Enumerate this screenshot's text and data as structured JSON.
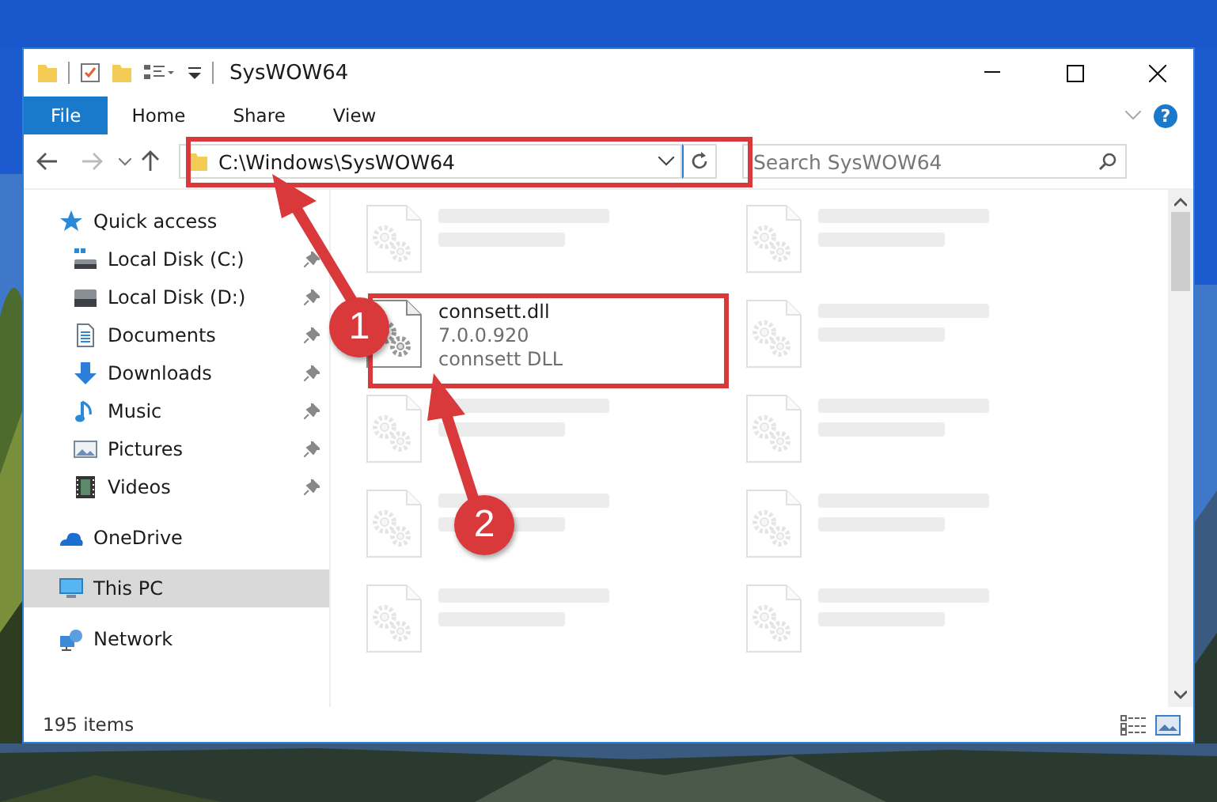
{
  "window": {
    "title": "SysWOW64"
  },
  "ribbon": {
    "tabs": [
      {
        "label": "File",
        "selected": true
      },
      {
        "label": "Home",
        "selected": false
      },
      {
        "label": "Share",
        "selected": false
      },
      {
        "label": "View",
        "selected": false
      }
    ],
    "help": "?"
  },
  "address": {
    "path": "C:\\Windows\\SysWOW64"
  },
  "search": {
    "placeholder": "Search SysWOW64"
  },
  "sidebar": {
    "items": [
      {
        "label": "Quick access",
        "kind": "star",
        "selected": false,
        "children": [
          {
            "label": "Local Disk (C:)",
            "kind": "system-drive",
            "pinned": true,
            "selected": false
          },
          {
            "label": "Local Disk (D:)",
            "kind": "drive",
            "pinned": true,
            "selected": false
          },
          {
            "label": "Documents",
            "kind": "document",
            "pinned": true,
            "selected": false
          },
          {
            "label": "Downloads",
            "kind": "download",
            "pinned": true,
            "selected": false
          },
          {
            "label": "Music",
            "kind": "music",
            "pinned": true,
            "selected": false
          },
          {
            "label": "Pictures",
            "kind": "pictures",
            "pinned": true,
            "selected": false
          },
          {
            "label": "Videos",
            "kind": "videos",
            "pinned": true,
            "selected": false
          }
        ]
      },
      {
        "label": "OneDrive",
        "kind": "cloud",
        "selected": false
      },
      {
        "label": "This PC",
        "kind": "computer",
        "selected": true
      },
      {
        "label": "Network",
        "kind": "network",
        "selected": false
      }
    ]
  },
  "files": [
    {
      "faded": true
    },
    {
      "faded": true
    },
    {
      "name": "connsett.dll",
      "details": [
        "7.0.0.920",
        "connsett DLL"
      ],
      "faded": false
    },
    {
      "faded": true
    },
    {
      "faded": true
    },
    {
      "faded": true
    },
    {
      "faded": true
    },
    {
      "faded": true
    },
    {
      "faded": true
    },
    {
      "faded": true
    }
  ],
  "status_bar": {
    "count": "195 items"
  },
  "callouts": [
    {
      "number": "1"
    },
    {
      "number": "2"
    }
  ]
}
